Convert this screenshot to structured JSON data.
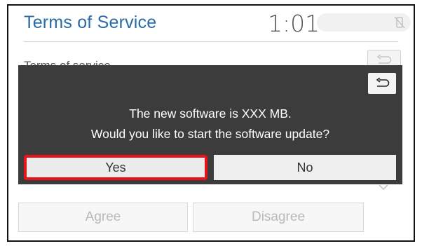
{
  "header": {
    "title": "Terms of Service",
    "clock": "1:01",
    "status_icon": "no-signal-icon"
  },
  "background": {
    "body_text": "Terms of service",
    "back_icon": "back-arrow-icon",
    "scroll_icon": "chevron-down-icon",
    "agree_label": "Agree",
    "disagree_label": "Disagree"
  },
  "dialog": {
    "back_icon": "back-arrow-icon",
    "message_line1": "The new software is XXX MB.",
    "message_line2": "Would you like to start the software update?",
    "yes_label": "Yes",
    "no_label": "No",
    "highlight_color": "#e8141c"
  },
  "colors": {
    "title": "#2a6aa8",
    "dialog_bg": "#3c3c3c"
  }
}
